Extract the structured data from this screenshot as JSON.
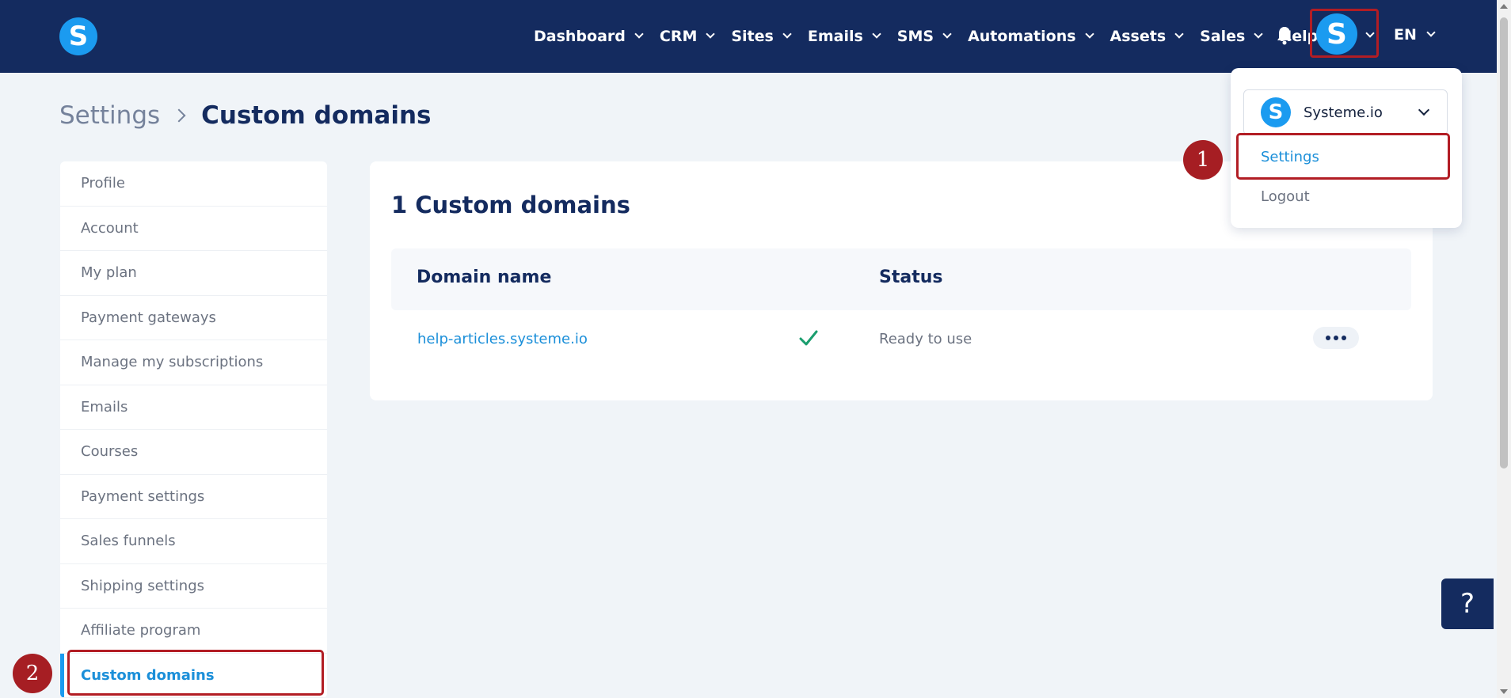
{
  "nav": {
    "logo_letter": "S",
    "items": [
      {
        "label": "Dashboard",
        "has_dropdown": true
      },
      {
        "label": "CRM",
        "has_dropdown": true
      },
      {
        "label": "Sites",
        "has_dropdown": true
      },
      {
        "label": "Emails",
        "has_dropdown": true
      },
      {
        "label": "SMS",
        "has_dropdown": true
      },
      {
        "label": "Automations",
        "has_dropdown": true
      },
      {
        "label": "Assets",
        "has_dropdown": true
      },
      {
        "label": "Sales",
        "has_dropdown": true
      },
      {
        "label": "Help",
        "has_dropdown": false
      }
    ],
    "bell_icon": "bell-icon",
    "avatar_letter": "S",
    "language": "EN"
  },
  "breadcrumb": {
    "parent": "Settings",
    "current": "Custom domains"
  },
  "sidebar": {
    "items": [
      {
        "label": "Profile",
        "active": false
      },
      {
        "label": "Account",
        "active": false
      },
      {
        "label": "My plan",
        "active": false
      },
      {
        "label": "Payment gateways",
        "active": false
      },
      {
        "label": "Manage my subscriptions",
        "active": false
      },
      {
        "label": "Emails",
        "active": false
      },
      {
        "label": "Courses",
        "active": false
      },
      {
        "label": "Payment settings",
        "active": false
      },
      {
        "label": "Sales funnels",
        "active": false
      },
      {
        "label": "Shipping settings",
        "active": false
      },
      {
        "label": "Affiliate program",
        "active": false
      },
      {
        "label": "Custom domains",
        "active": true
      }
    ]
  },
  "main": {
    "title": "1 Custom domains",
    "table": {
      "headers": [
        "Domain name",
        "Status"
      ],
      "rows": [
        {
          "domain": "help-articles.systeme.io",
          "status": "Ready to use",
          "status_icon": "check-icon"
        }
      ]
    }
  },
  "dropdown": {
    "account_letter": "S",
    "account_name": "Systeme.io",
    "settings_label": "Settings",
    "logout_label": "Logout"
  },
  "markers": {
    "step1": "1",
    "step2": "2"
  },
  "help_button": "?",
  "colors": {
    "nav_bg": "#142b5f",
    "brand_blue": "#1b9bf0",
    "link_blue": "#1b8fd9",
    "highlight_red": "#b21d24",
    "page_bg": "#f0f4f8",
    "success_green": "#1a9e6e"
  }
}
